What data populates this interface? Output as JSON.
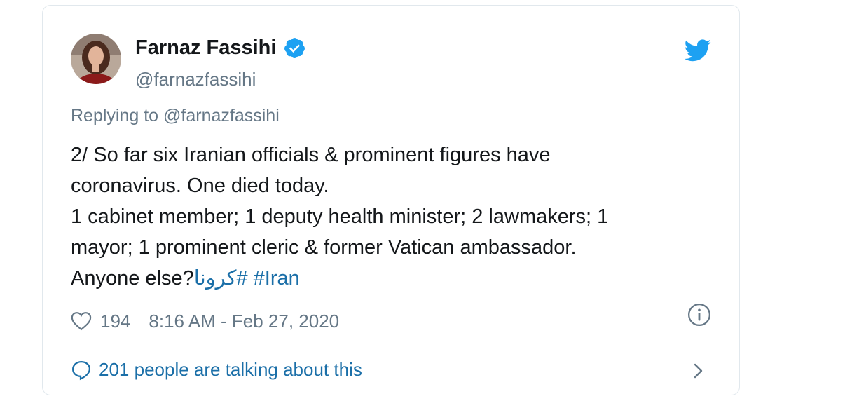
{
  "tweet": {
    "author": {
      "display_name": "Farnaz Fassihi",
      "handle": "@farnazfassihi",
      "verified": true,
      "avatar_icon": "avatar"
    },
    "replying_prefix": "Replying to",
    "replying_to": "@farnazfassihi",
    "text_lines": [
      "2/ So far six Iranian officials & prominent figures have",
      "coronavirus. One died today.",
      "1 cabinet member; 1 deputy health minister; 2 lawmakers; 1",
      "mayor; 1 prominent cleric & former Vatican ambassador.",
      "Anyone else?"
    ],
    "hashtags": [
      "#كرونا",
      "#Iran"
    ],
    "likes": "194",
    "timestamp": "8:16 AM - Feb 27, 2020",
    "talking_about": "201 people are talking about this"
  },
  "icons": {
    "brand": "twitter-bird-icon",
    "verified": "verified-badge-icon",
    "like": "heart-icon",
    "info": "info-icon",
    "conversation": "speech-bubble-icon",
    "more": "chevron-right-icon"
  },
  "colors": {
    "brand_blue": "#1da1f2",
    "link_blue": "#1b6fa8",
    "secondary_text": "#657786",
    "primary_text": "#14171a",
    "border": "#e1e8ed"
  }
}
